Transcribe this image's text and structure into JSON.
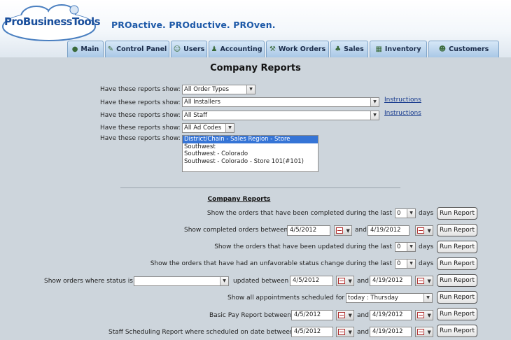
{
  "header": {
    "logo_text": "ProBusinessTools",
    "tagline": "PROactive. PROductive. PROven."
  },
  "nav": {
    "tabs": [
      {
        "label": "Main",
        "icon": "globe-icon"
      },
      {
        "label": "Control Panel",
        "icon": "wrench-icon"
      },
      {
        "label": "Users",
        "icon": "users-icon"
      },
      {
        "label": "Accounting",
        "icon": "accountant-icon"
      },
      {
        "label": "Work Orders",
        "icon": "work-orders-icon"
      },
      {
        "label": "Sales",
        "icon": "sales-icon"
      },
      {
        "label": "Inventory",
        "icon": "inventory-icon"
      },
      {
        "label": "Customers",
        "icon": "customers-icon"
      }
    ]
  },
  "page_title": "Company Reports",
  "filters": {
    "label": "Have these reports show:",
    "order_types": "All Order Types",
    "installers": "All Installers",
    "staff": "All Staff",
    "ad_codes": "All Ad Codes",
    "instructions_link": "Instructions",
    "region_options": [
      "District/Chain - Sales Region - Store",
      "Southwest",
      "Southwest - Colorado",
      "Southwest - Colorado - Store 101(#101)"
    ],
    "region_selected_index": 0
  },
  "reports": {
    "section_title": "Company Reports",
    "run_label": "Run Report",
    "and_label": "and",
    "days_label": "days",
    "r1_text": "Show the orders that have been completed during the last",
    "r1_days": "0",
    "r2_text": "Show completed orders between",
    "r2_from": "4/5/2012",
    "r2_to": "4/19/2012",
    "r3_text": "Show the orders that have been updated during the last",
    "r3_days": "0",
    "r4_text": "Show the orders that have had an unfavorable status change during the last",
    "r4_days": "0",
    "r5_text": "Show orders where status is",
    "r5_status": "",
    "r5_mid": "updated between",
    "r5_from": "4/5/2012",
    "r5_to": "4/19/2012",
    "r6_text": "Show all appointments scheduled for",
    "r6_value": "today : Thursday",
    "r7_text": "Basic Pay Report between",
    "r7_from": "4/5/2012",
    "r7_to": "4/19/2012",
    "r8_text": "Staff Scheduling Report where scheduled on date between",
    "r8_from": "4/5/2012",
    "r8_to": "4/19/2012"
  }
}
